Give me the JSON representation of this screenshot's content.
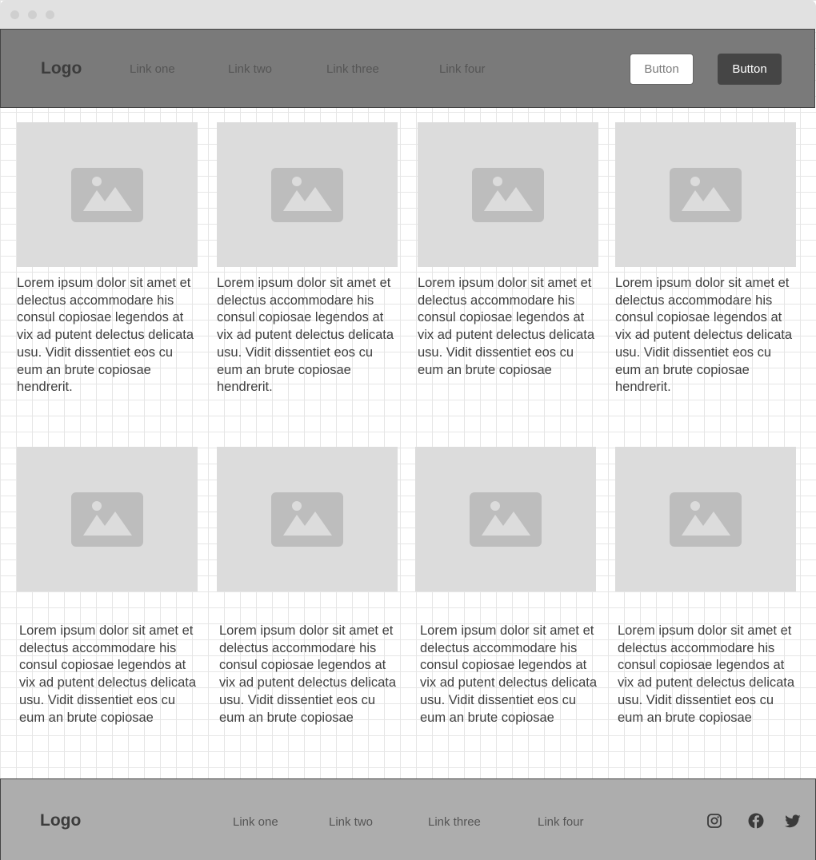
{
  "header": {
    "logo": "Logo",
    "nav": [
      "Link one",
      "Link two",
      "Link three",
      "Link four"
    ],
    "button_outline": "Button",
    "button_solid": "Button"
  },
  "cards_row1": [
    {
      "text": "Lorem ipsum dolor sit amet et delectus accommodare his consul copiosae legendos at vix ad putent delectus delicata usu. Vidit dissentiet eos cu eum an brute copiosae hendrerit.",
      "image_icon": "image-placeholder-icon"
    },
    {
      "text": "Lorem ipsum dolor sit amet et delectus accommodare his consul copiosae legendos at vix ad putent delectus delicata usu. Vidit dissentiet eos cu eum an brute copiosae hendrerit.",
      "image_icon": "image-placeholder-icon"
    },
    {
      "text": "Lorem ipsum dolor sit amet et delectus accommodare his consul copiosae legendos at vix ad putent delectus delicata usu. Vidit dissentiet eos cu eum an brute copiosae",
      "image_icon": "image-placeholder-icon"
    },
    {
      "text": "Lorem ipsum dolor sit amet et delectus accommodare his consul copiosae legendos at vix ad putent delectus delicata usu. Vidit dissentiet eos cu eum an brute copiosae hendrerit.",
      "image_icon": "image-placeholder-icon"
    }
  ],
  "cards_row2": [
    {
      "text": "Lorem ipsum dolor sit amet et delectus accommodare his consul copiosae legendos at vix ad putent delectus delicata usu. Vidit dissentiet eos cu eum an brute copiosae",
      "image_icon": "image-placeholder-icon"
    },
    {
      "text": "Lorem ipsum dolor sit amet et delectus accommodare his consul copiosae legendos at vix ad putent delectus delicata usu. Vidit dissentiet eos cu eum an brute copiosae",
      "image_icon": "image-placeholder-icon"
    },
    {
      "text": "Lorem ipsum dolor sit amet et delectus accommodare his consul copiosae legendos at vix ad putent delectus delicata usu. Vidit dissentiet eos cu eum an brute copiosae",
      "image_icon": "image-placeholder-icon"
    },
    {
      "text": "Lorem ipsum dolor sit amet et delectus accommodare his consul copiosae legendos at vix ad putent delectus delicata usu. Vidit dissentiet eos cu eum an brute copiosae",
      "image_icon": "image-placeholder-icon"
    }
  ],
  "footer": {
    "logo": "Logo",
    "nav": [
      "Link one",
      "Link two",
      "Link three",
      "Link four"
    ],
    "social": [
      "instagram-icon",
      "facebook-icon",
      "twitter-icon"
    ]
  },
  "colors": {
    "header_bg": "#7a7a7a",
    "footer_bg": "#adadad",
    "placeholder_bg": "#dcdcdc",
    "placeholder_icon": "#bdbdbd",
    "button_solid_bg": "#454545"
  }
}
